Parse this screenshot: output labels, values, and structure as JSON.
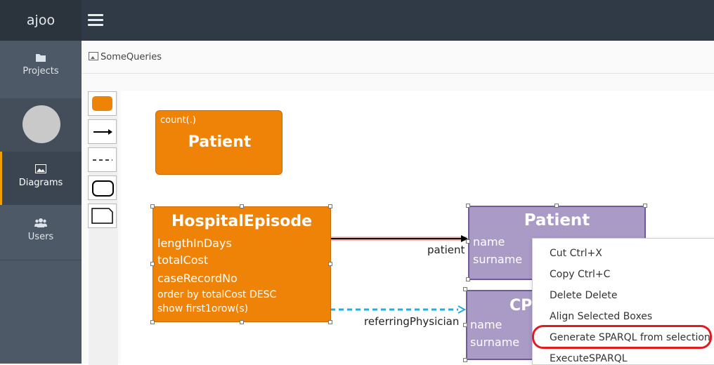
{
  "app": {
    "brand": "ajoo"
  },
  "sidebar": {
    "items": [
      {
        "label": "Projects",
        "icon": "folder-icon"
      },
      {
        "label": "Diagrams",
        "icon": "image-icon"
      },
      {
        "label": "Users",
        "icon": "users-icon"
      }
    ]
  },
  "breadcrumb": {
    "label": "SomeQueries"
  },
  "palette": {
    "items": [
      "orange-box-tool",
      "arrow-line-tool",
      "dashed-line-tool",
      "rounded-rect-tool",
      "folded-rect-tool"
    ]
  },
  "diagram": {
    "count_box": {
      "prefix": "count(.)",
      "title": "Patient"
    },
    "episode_box": {
      "title": "HospitalEpisode",
      "attributes": [
        "lengthInDays",
        "totalCost",
        "caseRecordNo"
      ],
      "order_text": "order by totalCost DESC",
      "show_text": "show first1orow(s)"
    },
    "patient_box": {
      "title": "Patient",
      "attributes": [
        "name",
        "surname"
      ]
    },
    "cp_box": {
      "title": "CP",
      "attributes": [
        "name",
        "surname"
      ]
    },
    "links": [
      {
        "label": "patient"
      },
      {
        "label": "referringPhysician"
      }
    ],
    "colors": {
      "orange": "#ef8308",
      "purple": "#aa9bc6",
      "dashed_link": "#2aa9e0"
    }
  },
  "context_menu": {
    "items": [
      "Cut Ctrl+X",
      "Copy Ctrl+C",
      "Delete Delete",
      "Align Selected Boxes",
      "Generate SPARQL from selection",
      "ExecuteSPARQL"
    ],
    "highlighted_index": 4,
    "highlight_color": "#e21b23"
  }
}
